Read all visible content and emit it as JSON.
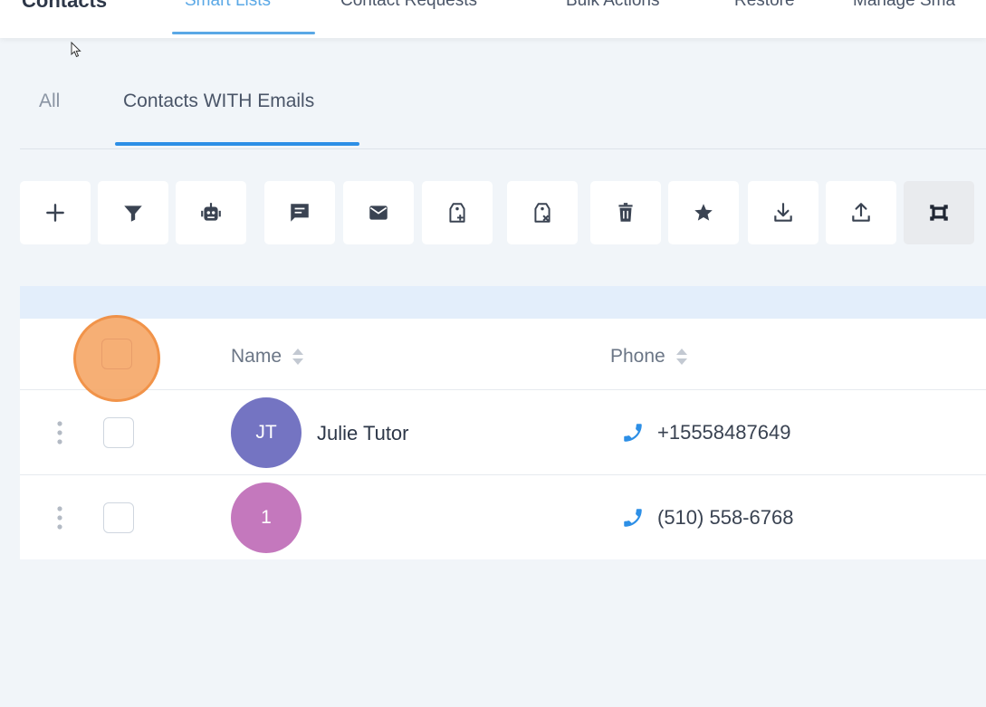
{
  "top_nav": {
    "title": "Contacts",
    "tabs": [
      {
        "label": "Smart Lists",
        "active": true
      },
      {
        "label": "Contact Requests",
        "active": false
      },
      {
        "label": "Bulk Actions",
        "active": false
      },
      {
        "label": "Restore",
        "active": false
      },
      {
        "label": "Manage Sma",
        "active": false
      }
    ]
  },
  "sub_tabs": [
    {
      "label": "All",
      "active": false
    },
    {
      "label": "Contacts WITH Emails",
      "active": true
    }
  ],
  "toolbar": {
    "buttons": [
      {
        "icon": "plus-icon",
        "action": "add-contact"
      },
      {
        "icon": "filter-icon",
        "action": "filter"
      },
      {
        "icon": "robot-icon",
        "action": "automation"
      },
      {
        "icon": "message-icon",
        "action": "send-sms"
      },
      {
        "icon": "mail-icon",
        "action": "send-email"
      },
      {
        "icon": "tag-add-icon",
        "action": "add-tag"
      },
      {
        "icon": "tag-remove-icon",
        "action": "remove-tag"
      },
      {
        "icon": "trash-icon",
        "action": "delete"
      },
      {
        "icon": "star-icon",
        "action": "review-request"
      },
      {
        "icon": "download-icon",
        "action": "export"
      },
      {
        "icon": "upload-icon",
        "action": "import"
      },
      {
        "icon": "merge-icon",
        "action": "merge",
        "active": true
      }
    ]
  },
  "table": {
    "columns": {
      "name": "Name",
      "phone": "Phone"
    },
    "rows": [
      {
        "initials": "JT",
        "name": "Julie Tutor",
        "phone": "+15558487649",
        "avatar_color": "#7474c2"
      },
      {
        "initials": "1",
        "name": "",
        "phone": "(510) 558-6768",
        "avatar_color": "#c478bd"
      }
    ]
  },
  "colors": {
    "accent": "#2d8fe6",
    "nav_active": "#5aa8e6",
    "highlight": "#f6a96a",
    "phone_icon": "#2d8fe6"
  }
}
